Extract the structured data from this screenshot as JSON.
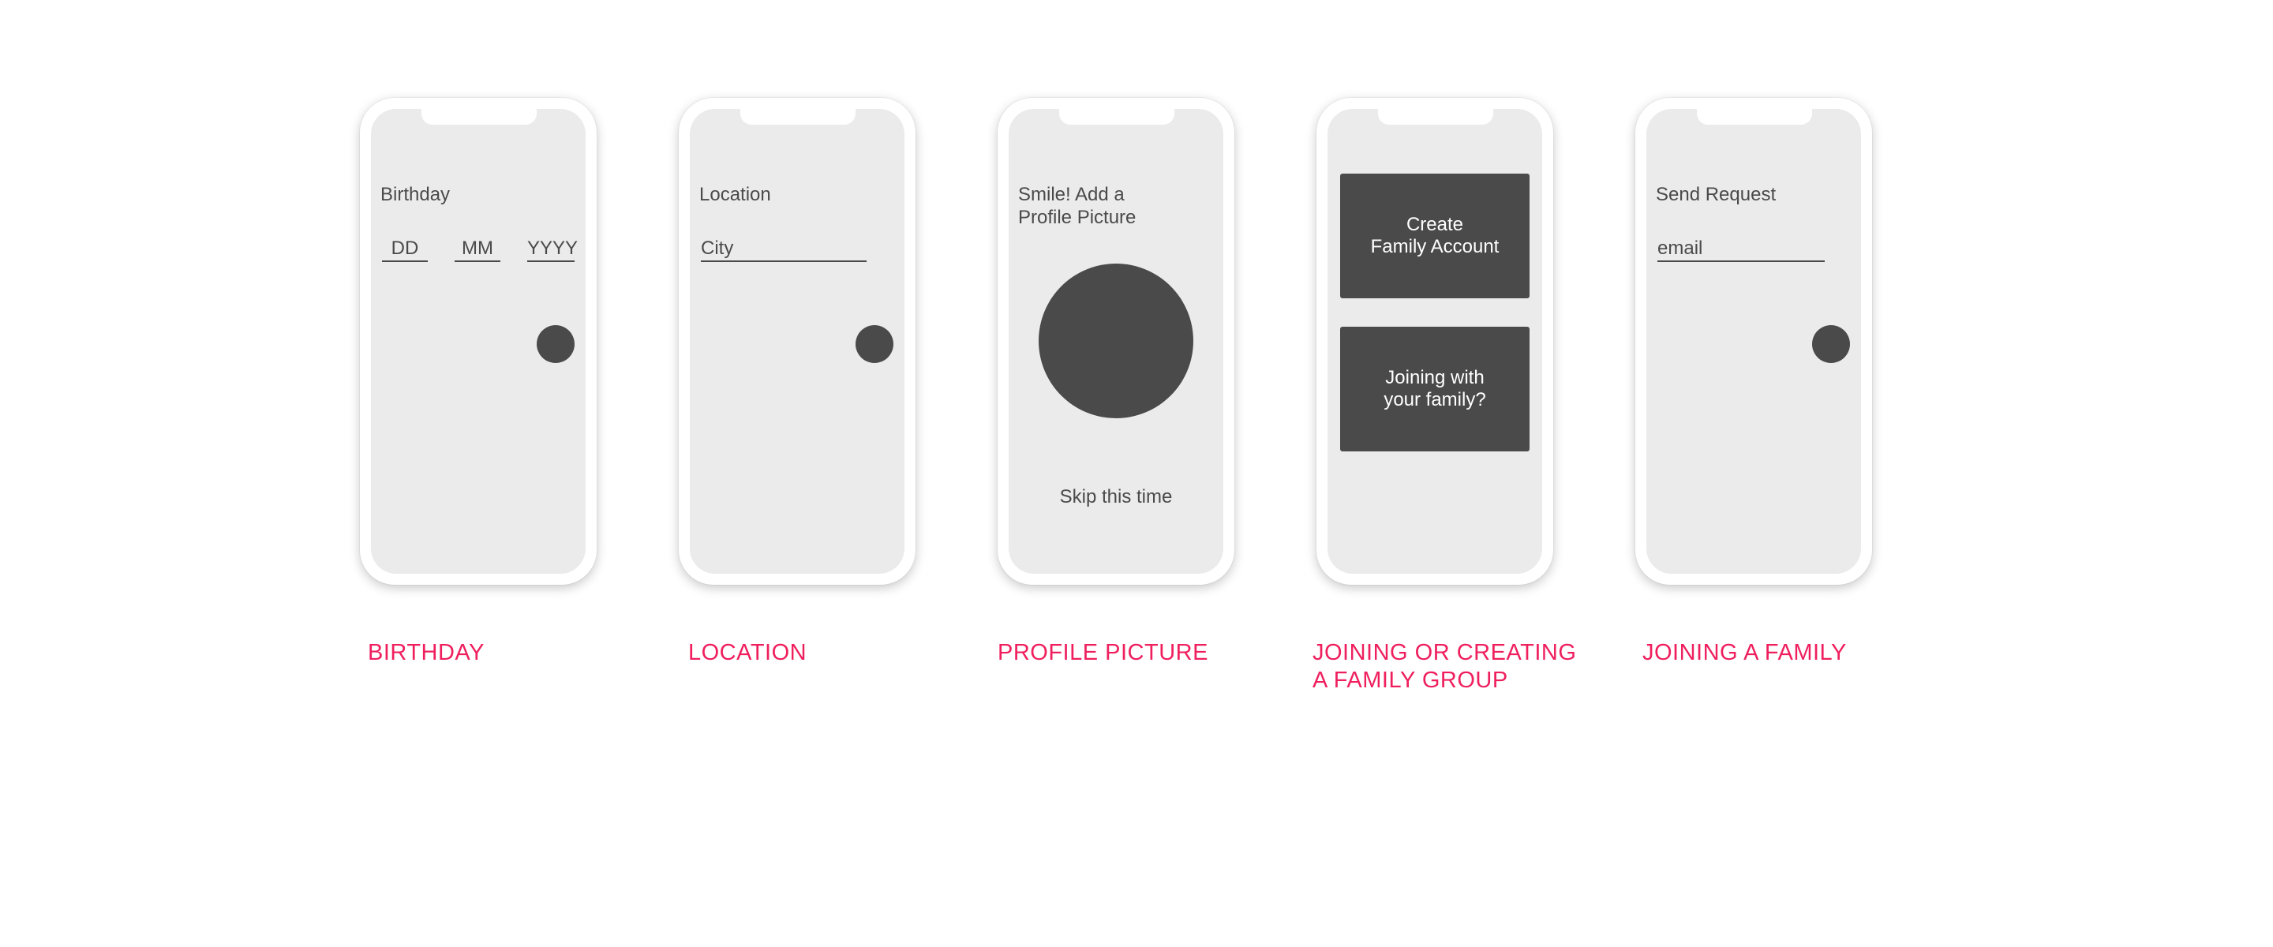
{
  "screens": [
    {
      "caption": "BIRTHDAY",
      "title": "Birthday",
      "fields": [
        "DD",
        "MM",
        "YYYY"
      ]
    },
    {
      "caption": "LOCATION",
      "title": "Location",
      "field": "City"
    },
    {
      "caption": "PROFILE PICTURE",
      "title": "Smile! Add a\nProfile Picture",
      "skip": "Skip this time"
    },
    {
      "caption": "JOINING OR CREATING\nA FAMILY GROUP",
      "create": "Create\nFamily Account",
      "join": "Joining with\nyour family?"
    },
    {
      "caption": "JOINING A FAMILY",
      "title": "Send Request",
      "field": "email"
    }
  ],
  "colors": {
    "screen_bg": "#ebebeb",
    "dark": "#4a4a4a",
    "caption": "#ef1f5e"
  },
  "icons": {
    "next_button": "circle-next-icon"
  }
}
